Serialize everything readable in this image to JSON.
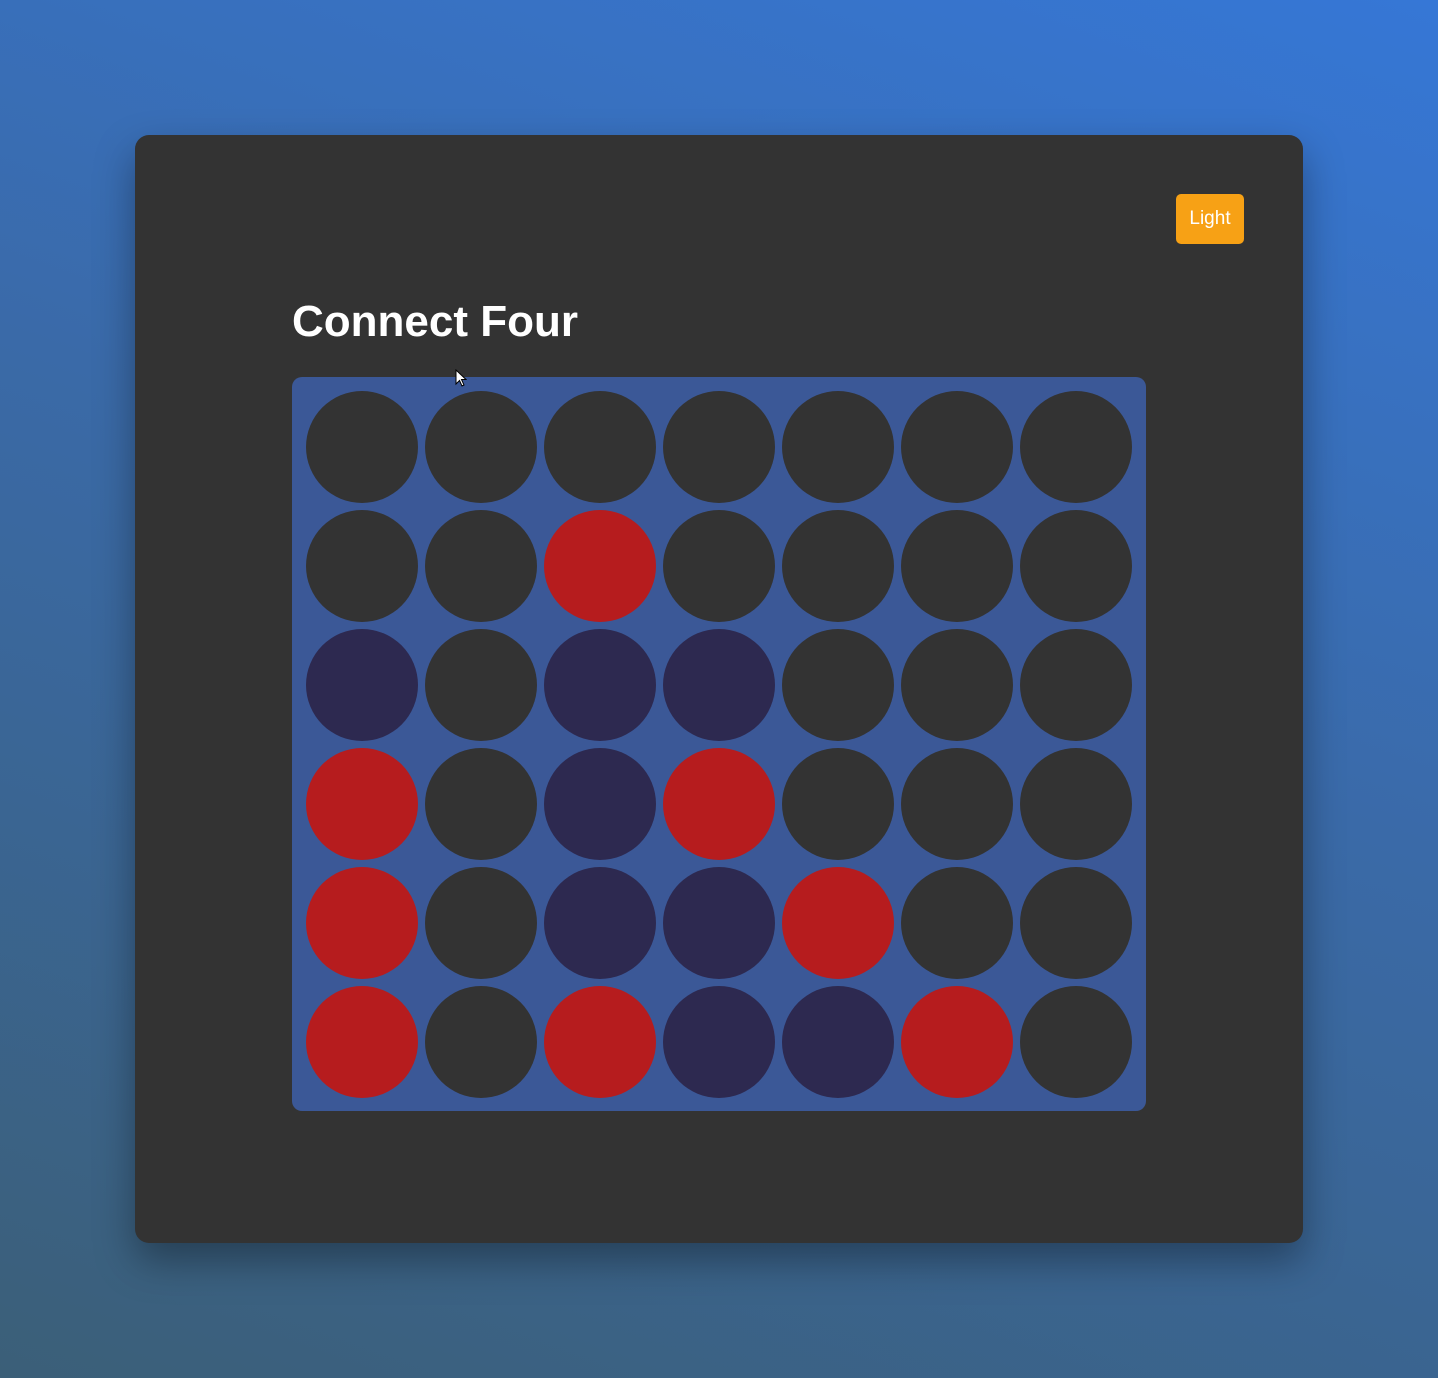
{
  "app": {
    "title": "Connect Four"
  },
  "theme_toggle": {
    "label": "Light",
    "color": "#f7a115"
  },
  "colors": {
    "window_bg": "#333333",
    "board_bg": "#3b5897",
    "empty": "#333333",
    "red": "#b61c1e",
    "purple": "#2d2950"
  },
  "board": {
    "columns": 7,
    "rows": 6,
    "cells": [
      [
        "empty",
        "empty",
        "empty",
        "empty",
        "empty",
        "empty",
        "empty"
      ],
      [
        "empty",
        "empty",
        "red",
        "empty",
        "empty",
        "empty",
        "empty"
      ],
      [
        "purple",
        "empty",
        "purple",
        "purple",
        "empty",
        "empty",
        "empty"
      ],
      [
        "red",
        "empty",
        "purple",
        "red",
        "empty",
        "empty",
        "empty"
      ],
      [
        "red",
        "empty",
        "purple",
        "purple",
        "red",
        "empty",
        "empty"
      ],
      [
        "red",
        "empty",
        "red",
        "purple",
        "purple",
        "red",
        "empty"
      ]
    ]
  }
}
